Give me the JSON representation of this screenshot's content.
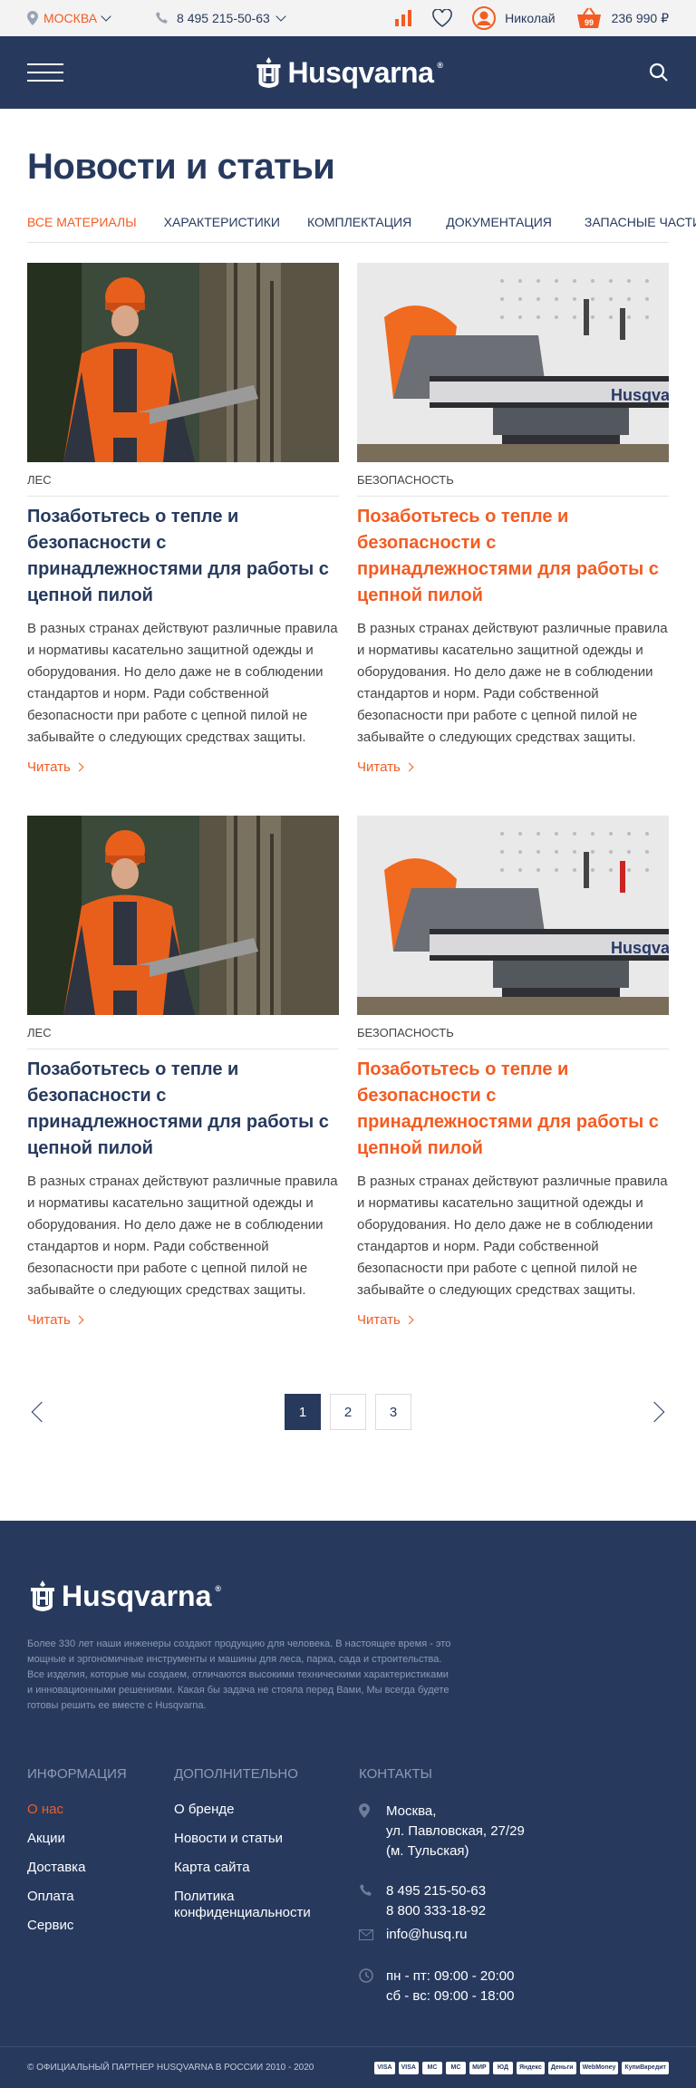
{
  "topbar": {
    "city": "МОСКВА",
    "phone": "8 495 215-50-63",
    "user": "Николай",
    "cart_count": "99",
    "cart_total": "236 990 ₽"
  },
  "header": {
    "brand": "Husqvarna"
  },
  "page_title": "Новости и статьи",
  "tabs": [
    {
      "label": "ВСЕ МАТЕРИАЛЫ"
    },
    {
      "label": "ХАРАКТЕРИСТИКИ"
    },
    {
      "label": "КОМПЛЕКТАЦИЯ"
    },
    {
      "label": "ДОКУМЕНТАЦИЯ"
    },
    {
      "label": "ЗАПАСНЫЕ ЧАСТИ"
    }
  ],
  "articles": [
    {
      "category": "ЛЕС",
      "title": "Позаботьтесь о тепле и безопасности с принадлежностями для работы с цепной пилой",
      "text": "В разных странах действуют различные правила и нормативы касательно защитной одежды и оборудования. Но дело даже не в соблюдении стандартов и норм. Ради собственной безопасности при работе с цепной пилой не забывайте о следующих средствах защиты.",
      "more": "Читать"
    },
    {
      "category": "БЕЗОПАСНОСТЬ",
      "title": "Позаботьтесь о тепле и безопасности с принадлежностями для работы с цепной пилой",
      "text": "В разных странах действуют различные правила и нормативы касательно защитной одежды и оборудования. Но дело даже не в соблюдении стандартов и норм. Ради собственной безопасности при работе с цепной пилой не забывайте о следующих средствах защиты.",
      "more": "Читать"
    },
    {
      "category": "ЛЕС",
      "title": "Позаботьтесь о тепле и безопасности с принадлежностями для работы с цепной пилой",
      "text": "В разных странах действуют различные правила и нормативы касательно защитной одежды и оборудования. Но дело даже не в соблюдении стандартов и норм. Ради собственной безопасности при работе с цепной пилой не забывайте о следующих средствах защиты.",
      "more": "Читать"
    },
    {
      "category": "БЕЗОПАСНОСТЬ",
      "title": "Позаботьтесь о тепле и безопасности с принадлежностями для работы с цепной пилой",
      "text": "В разных странах действуют различные правила и нормативы касательно защитной одежды и оборудования. Но дело даже не в соблюдении стандартов и норм. Ради собственной безопасности при работе с цепной пилой не забывайте о следующих средствах защиты.",
      "more": "Читать"
    }
  ],
  "image_print": "Husqvarna",
  "pagination": [
    "1",
    "2",
    "3"
  ],
  "footer": {
    "about": "Более 330 лет наши инженеры создают продукцию для человека. В настоящее время - это мощные и эргономичные инструменты и машины для леса, парка, сада и строительства. Все изделия, которые мы создаем, отличаются высокими техническими характеристиками и инновационными решениями. Какая бы задача не стояла перед Вами, Мы всегда будете готовы решить ее вместе с Husqvarna.",
    "info_head": "ИНФОРМАЦИЯ",
    "info": [
      "О нас",
      "Акции",
      "Доставка",
      "Оплата",
      "Сервис"
    ],
    "extra_head": "ДОПОЛНИТЕЛЬНО",
    "extra": [
      "О бренде",
      "Новости и статьи",
      "Карта сайта",
      "Политика конфиденциальности"
    ],
    "contacts_head": "КОНТАКТЫ",
    "address": [
      "Москва,",
      "ул. Павловская, 27/29",
      "(м. Тульская)"
    ],
    "phones": [
      "8 495 215-50-63",
      "8 800 333-18-92"
    ],
    "email": "info@husq.ru",
    "hours": [
      "пн - пт: 09:00 - 20:00",
      "сб - вс: 09:00 - 18:00"
    ],
    "copyright": "© ОФИЦИАЛЬНЫЙ ПАРТНЕР HUSQVARNA В РОССИИ 2010 - 2020",
    "payments": [
      "VISA",
      "VISA",
      "MC",
      "MC",
      "МИР",
      "ЮД",
      "Яндекс",
      "Деньги",
      "WebMoney",
      "КупиВкредит"
    ]
  },
  "colors": {
    "navy": "#273a5e",
    "orange": "#f35c22"
  }
}
